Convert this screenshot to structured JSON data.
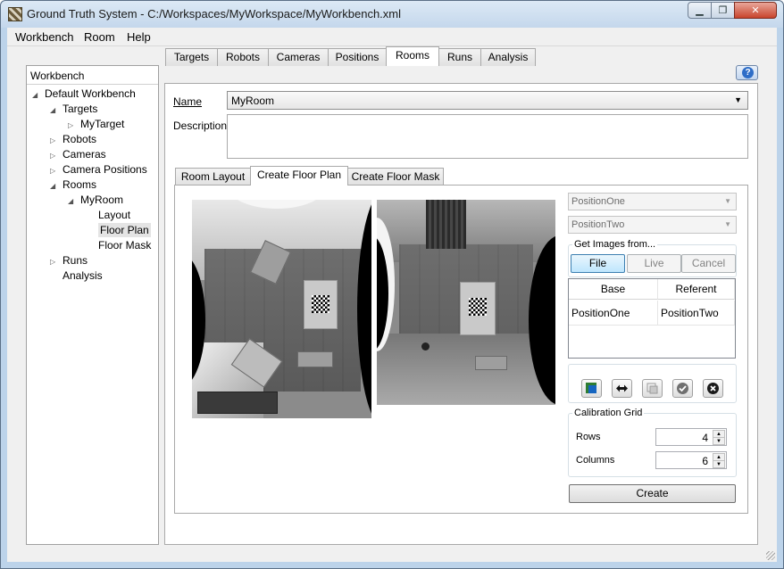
{
  "window": {
    "title": "Ground Truth System - C:/Workspaces/MyWorkspace/MyWorkbench.xml",
    "min_glyph": "▁",
    "max_glyph": "❐",
    "close_glyph": "✕"
  },
  "menu": [
    {
      "label": "Workbench"
    },
    {
      "label": "Room"
    },
    {
      "label": "Help"
    }
  ],
  "tree": {
    "header": "Workbench",
    "items": [
      {
        "label": "Default Workbench",
        "arrow": "◢"
      },
      {
        "label": "Targets",
        "arrow": "◢"
      },
      {
        "label": "MyTarget",
        "arrow": "▷"
      },
      {
        "label": "Robots",
        "arrow": "▷"
      },
      {
        "label": "Cameras",
        "arrow": "▷"
      },
      {
        "label": "Camera Positions",
        "arrow": "▷"
      },
      {
        "label": "Rooms",
        "arrow": "◢"
      },
      {
        "label": "MyRoom",
        "arrow": "◢"
      },
      {
        "label": "Layout",
        "arrow": ""
      },
      {
        "label": "Floor Plan",
        "arrow": ""
      },
      {
        "label": "Floor Mask",
        "arrow": ""
      },
      {
        "label": "Runs",
        "arrow": "▷"
      },
      {
        "label": "Analysis",
        "arrow": ""
      }
    ],
    "selected": "Floor Plan"
  },
  "tabs": [
    {
      "label": "Targets"
    },
    {
      "label": "Robots"
    },
    {
      "label": "Cameras"
    },
    {
      "label": "Positions"
    },
    {
      "label": "Rooms"
    },
    {
      "label": "Runs"
    },
    {
      "label": "Analysis"
    }
  ],
  "active_tab": "Rooms",
  "help_glyph": "?",
  "form": {
    "name_label": "Name",
    "name_value": "MyRoom",
    "description_label": "Description",
    "description_value": ""
  },
  "subtabs": [
    {
      "label": "Room Layout"
    },
    {
      "label": "Create Floor Plan"
    },
    {
      "label": "Create Floor Mask"
    }
  ],
  "active_subtab": "Create Floor Plan",
  "floor_plan": {
    "position_one": "PositionOne",
    "position_two": "PositionTwo",
    "get_images_title": "Get Images from...",
    "file_button": "File",
    "live_button": "Live",
    "cancel_button": "Cancel",
    "table": {
      "columns": [
        "Base",
        "Referent"
      ],
      "rows": [
        [
          "PositionOne",
          "PositionTwo"
        ]
      ]
    },
    "toolbar_icons": [
      "add-image-icon",
      "swap-arrows-icon",
      "copy-icon",
      "check-icon",
      "remove-icon"
    ],
    "calibration_title": "Calibration Grid",
    "rows_label": "Rows",
    "rows_value": "4",
    "columns_label": "Columns",
    "columns_value": "6",
    "create_button": "Create"
  }
}
